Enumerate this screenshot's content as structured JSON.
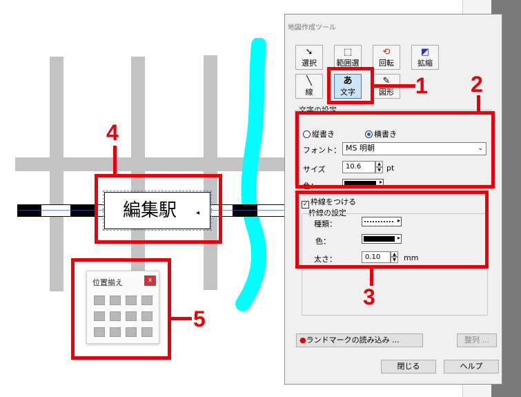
{
  "map": {
    "station_label": "編集駅"
  },
  "palette": {
    "title": "位置揃え",
    "close": "x"
  },
  "dialog": {
    "title": "地図作成ツール",
    "tools": {
      "select": "選択",
      "range_select": "範囲選",
      "rotate": "回転",
      "zoom": "拡縮",
      "line": "線",
      "text": "文字",
      "shape": "図形",
      "text_icon": "あ"
    },
    "text_settings": {
      "group_label": "文字の設定",
      "vertical": "縦書き",
      "horizontal": "横書き",
      "font_label": "フォント：",
      "font_value": "MS 明朝",
      "size_label": "サイズ",
      "size_value": "10.6",
      "size_unit": "pt",
      "color_label": "色："
    },
    "border": {
      "checkbox_label": "枠線をつける",
      "group_label": "枠線の設定",
      "type_label": "種類：",
      "color_label": "色：",
      "thickness_label": "太さ：",
      "thickness_value": "0.10",
      "thickness_unit": "mm"
    },
    "landmark_button": "ランドマークの読み込み ...",
    "align_button": "整列 ...",
    "close_button": "閉じる",
    "help_button": "ヘルプ"
  },
  "callouts": {
    "c1": "1",
    "c2": "2",
    "c3": "3",
    "c4": "4",
    "c5": "5"
  },
  "colors": {
    "callout_red": "#e8000b",
    "river": "#00ffff",
    "road": "#c3c3c3",
    "radio_accent": "#1a5fb4"
  }
}
